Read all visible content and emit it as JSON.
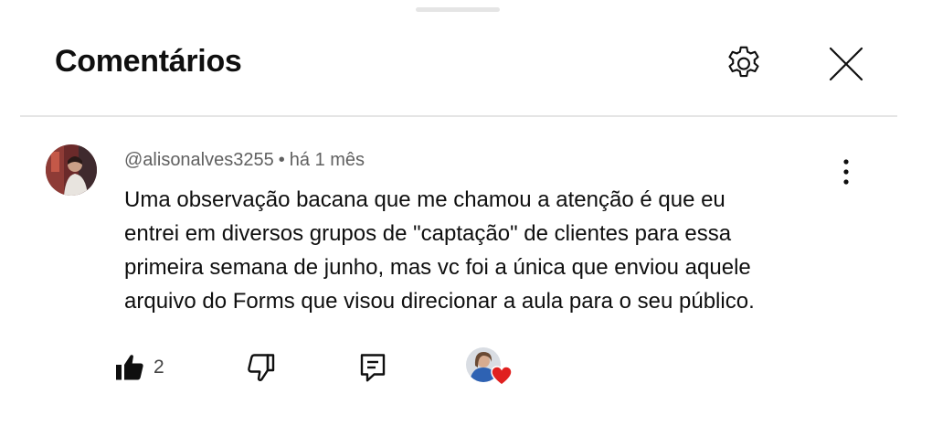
{
  "header": {
    "title": "Comentários",
    "settings_icon": "gear-icon",
    "close_icon": "close-icon"
  },
  "comment": {
    "author": "@alisonalves3255",
    "separator": "•",
    "time": "há 1 mês",
    "text_lines": [
      "Uma observação bacana que me chamou a atenção é que eu",
      "entrei em diversos grupos de \"captação\" de clientes para essa",
      "primeira semana de junho, mas vc foi a única que enviou aquele",
      "arquivo do Forms que visou direcionar a aula para o seu público."
    ],
    "like_count": "2",
    "icons": {
      "more": "more-vertical-icon",
      "like": "thumbs-up-icon",
      "dislike": "thumbs-down-icon",
      "reply": "reply-icon",
      "heart": "heart-icon"
    }
  },
  "colors": {
    "text": "#0f0f0f",
    "secondary_text": "#606060",
    "divider": "#e5e5e5",
    "heart": "#e0201f"
  }
}
